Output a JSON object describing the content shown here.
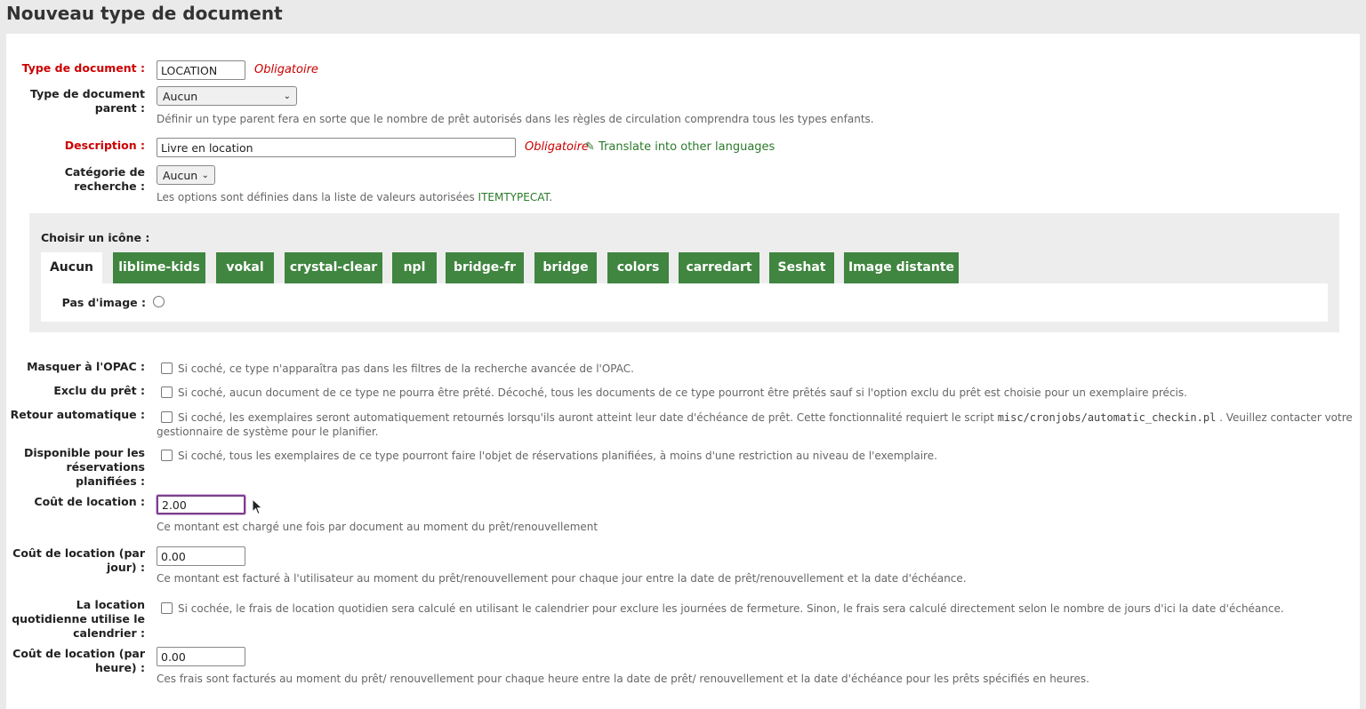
{
  "page_title": "Nouveau type de document",
  "fields": {
    "itemtype": {
      "label": "Type de document :",
      "value": "LOCATION",
      "required": "Obligatoire"
    },
    "parent": {
      "label": "Type de document parent :",
      "selected": "Aucun",
      "hint": "Définir un type parent fera en sorte que le nombre de prêt autorisés dans les règles de circulation comprendra tous les types enfants."
    },
    "description": {
      "label": "Description :",
      "value": "Livre en location",
      "required": "Obligatoire",
      "translate_link": "Translate into other languages"
    },
    "category": {
      "label": "Catégorie de recherche :",
      "selected": "Aucun",
      "hint_prefix": "Les options sont définies dans la liste de valeurs autorisées ",
      "hint_link": "ITEMTYPECAT",
      "hint_suffix": "."
    }
  },
  "icons": {
    "label": "Choisir un icône :",
    "tabs": [
      "Aucun",
      "liblime-kids",
      "vokal",
      "crystal-clear",
      "npl",
      "bridge-fr",
      "bridge",
      "colors",
      "carredart",
      "Seshat",
      "Image distante"
    ],
    "active_tab": "Aucun",
    "no_image_label": "Pas d'image :"
  },
  "options": {
    "hide_opac": {
      "label": "Masquer à l'OPAC :",
      "text": "Si coché, ce type n'apparaîtra pas dans les filtres de la recherche avancée de l'OPAC."
    },
    "not_for_loan": {
      "label": "Exclu du prêt :",
      "text": "Si coché, aucun document de ce type ne pourra être prêté. Décoché, tous les documents de ce type pourront être prêtés sauf si l'option exclu du prêt est choisie pour un exemplaire précis."
    },
    "auto_return": {
      "label": "Retour automatique :",
      "text_a": "Si coché, les exemplaires seront automatiquement retournés lorsqu'ils auront atteint leur date d'échéance de prêt. Cette fonctionnalité requiert le script ",
      "script": "misc/cronjobs/automatic_checkin.pl",
      "text_b": " . Veuillez contacter votre",
      "text_c": "gestionnaire de système pour le planifier."
    },
    "bookable": {
      "label": "Disponible pour les réservations planifiées :",
      "text": "Si coché, tous les exemplaires de ce type pourront faire l'objet de réservations planifiées, à moins d'une restriction au niveau de l'exemplaire."
    }
  },
  "rental": {
    "charge": {
      "label": "Coût de location :",
      "value": "2.00",
      "hint": "Ce montant est chargé une fois par document au moment du prêt/renouvellement"
    },
    "daily": {
      "label": "Coût de location (par jour) :",
      "value": "0.00",
      "hint": "Ce montant est facturé à l'utilisateur au moment du prêt/renouvellement pour chaque jour entre la date de prêt/renouvellement et la date d'échéance."
    },
    "daily_calendar": {
      "label": "La location quotidienne utilise le calendrier :",
      "text": "Si cochée, le frais de location quotidien sera calculé en utilisant le calendrier pour exclure les journées de fermeture. Sinon, le frais sera calculé directement selon le nombre de jours d'ici la date d'échéance."
    },
    "hourly": {
      "label": "Coût de location (par heure) :",
      "value": "0.00",
      "hint": "Ces frais sont facturés au moment du prêt/ renouvellement pour chaque heure entre la date de prêt/ renouvellement et la date d'échéance pour les prêts spécifiés en heures."
    }
  },
  "colors": {
    "accent_green": "#408540",
    "required_red": "#cc0000",
    "focus_purple": "#7a3f8a"
  }
}
